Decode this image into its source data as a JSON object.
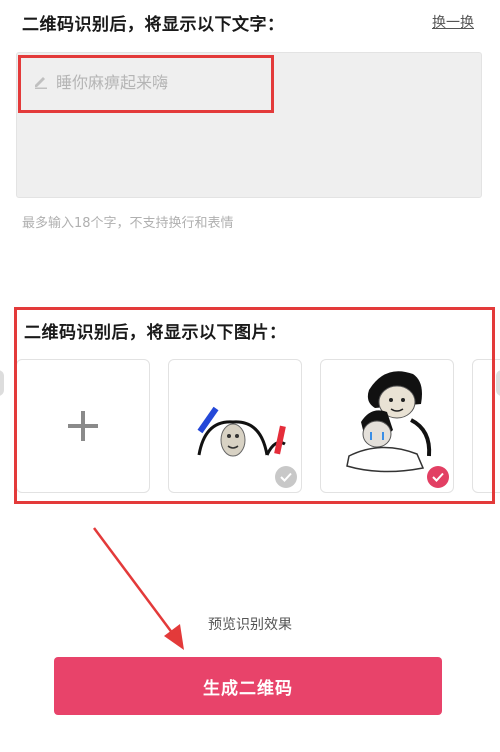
{
  "text_section": {
    "title": "二维码识别后，将显示以下文字：",
    "swap_label": "换一换",
    "placeholder": "睡你麻痹起来嗨",
    "hint": "最多输入18个字，不支持换行和表情"
  },
  "image_section": {
    "title": "二维码识别后，将显示以下图片：",
    "tiles": [
      {
        "kind": "add",
        "icon": "plus-icon"
      },
      {
        "kind": "sticker",
        "selected": false
      },
      {
        "kind": "sticker",
        "selected": true
      }
    ]
  },
  "preview_label": "预览识别效果",
  "generate_label": "生成二维码",
  "colors": {
    "accent": "#e8436a",
    "highlight": "#e33a3a",
    "check_selected": "#e23f63"
  }
}
